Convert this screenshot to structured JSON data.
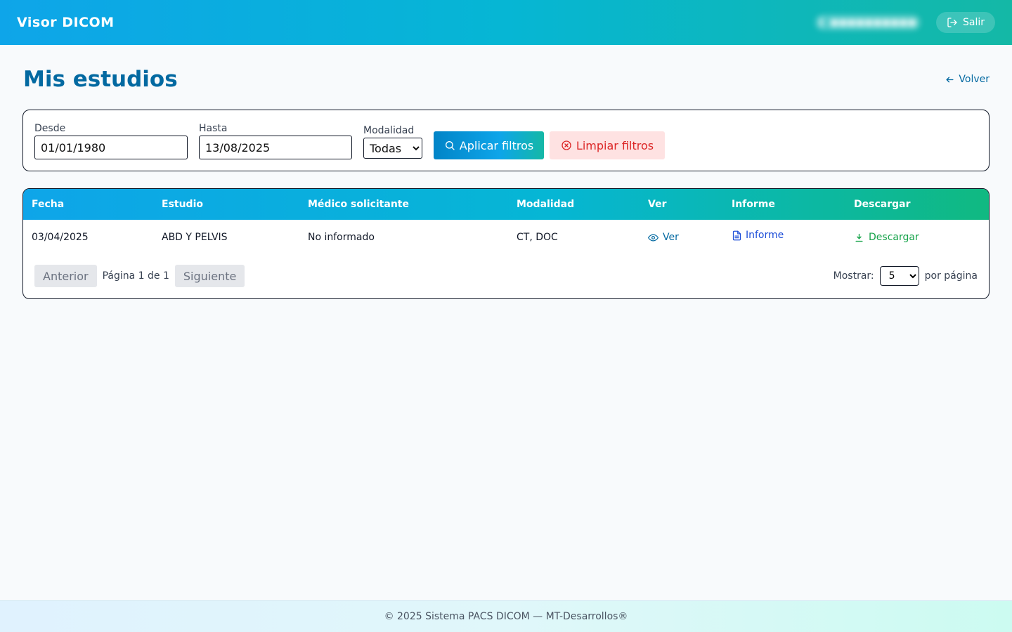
{
  "header": {
    "app_title": "Visor DICOM",
    "logout_label": "Salir"
  },
  "page": {
    "title": "Mis estudios",
    "back_label": "Volver"
  },
  "filters": {
    "desde_label": "Desde",
    "desde_value": "01/01/1980",
    "hasta_label": "Hasta",
    "hasta_value": "13/08/2025",
    "modalidad_label": "Modalidad",
    "modalidad_selected": "Todas",
    "apply_label": "Aplicar filtros",
    "clear_label": "Limpiar filtros"
  },
  "table": {
    "columns": [
      "Fecha",
      "Estudio",
      "Médico solicitante",
      "Modalidad",
      "Ver",
      "Informe",
      "Descargar"
    ],
    "rows": [
      {
        "fecha": "03/04/2025",
        "estudio": "ABD Y PELVIS",
        "medico": "No informado",
        "modalidad": "CT, DOC",
        "ver": "Ver",
        "informe": "Informe",
        "descargar": "Descargar"
      }
    ]
  },
  "pagination": {
    "prev_label": "Anterior",
    "page_info": "Página 1 de 1",
    "next_label": "Siguiente",
    "show_label": "Mostrar:",
    "per_page_value": "5",
    "per_page_suffix": "por página"
  },
  "footer": {
    "text": "© 2025 Sistema PACS DICOM — MT-Desarrollos®"
  }
}
